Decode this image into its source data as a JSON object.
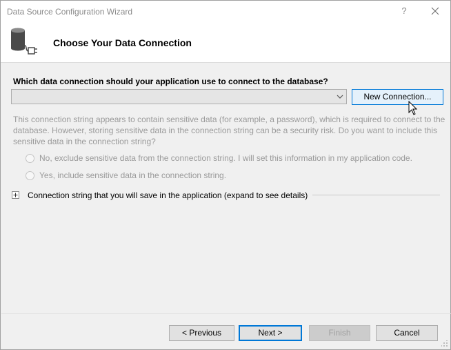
{
  "window": {
    "title": "Data Source Configuration Wizard",
    "help_label": "?",
    "close_icon": "close-icon"
  },
  "header": {
    "title": "Choose Your Data Connection",
    "icon": "database-plug-icon"
  },
  "connection": {
    "question": "Which data connection should your application use to connect to the database?",
    "selected_value": "",
    "new_connection_label": "New Connection..."
  },
  "sensitive": {
    "text": "This connection string appears to contain sensitive data (for example, a password), which is required to connect to the database. However, storing sensitive data in the connection string can be a security risk. Do you want to include this sensitive data in the connection string?",
    "options": [
      {
        "label": "No, exclude sensitive data from the connection string. I will set this information in my application code.",
        "checked": false
      },
      {
        "label": "Yes, include sensitive data in the connection string.",
        "checked": false
      }
    ]
  },
  "connection_string": {
    "expander_label": "Connection string that you will save in the application (expand to see details)",
    "expanded": false
  },
  "buttons": {
    "previous": "< Previous",
    "next": "Next >",
    "finish": "Finish",
    "cancel": "Cancel"
  },
  "colors": {
    "accent": "#0078d7",
    "disabled_text": "#9a9a9a"
  }
}
